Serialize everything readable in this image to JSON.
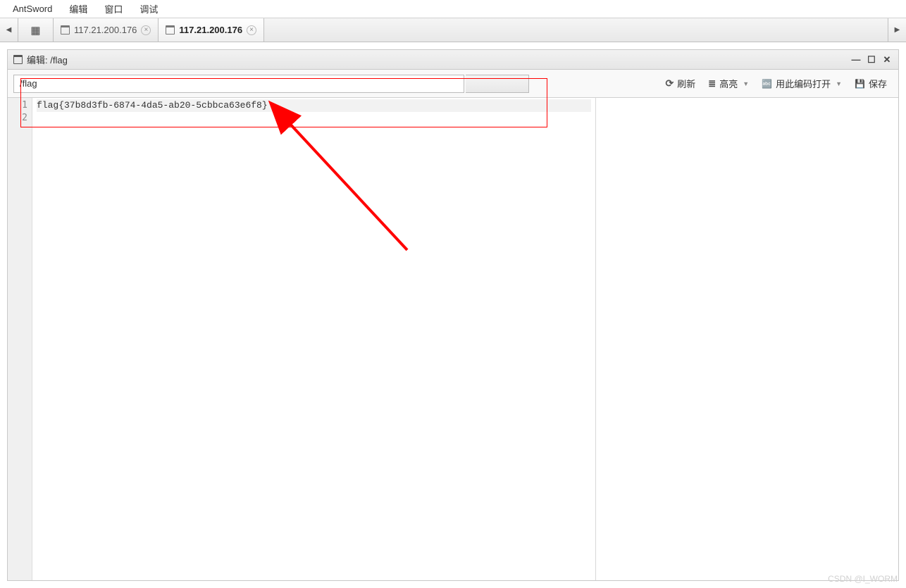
{
  "menubar": {
    "app": "AntSword",
    "items": [
      "编辑",
      "窗口",
      "调试"
    ]
  },
  "tabs": [
    {
      "label": "117.21.200.176",
      "active": false
    },
    {
      "label": "117.21.200.176",
      "active": true
    }
  ],
  "panel": {
    "title_prefix": "编辑: ",
    "title_path": "/flag"
  },
  "toolbar": {
    "path_value": "/flag",
    "refresh": "刷新",
    "highlight": "高亮",
    "encoding": "用此编码打开",
    "save": "保存"
  },
  "editor": {
    "lines": [
      {
        "num": "1",
        "text": "flag{37b8d3fb-6874-4da5-ab20-5cbbca63e6f8}"
      },
      {
        "num": "2",
        "text": ""
      }
    ]
  },
  "watermark": "CSDN @I_WORM"
}
